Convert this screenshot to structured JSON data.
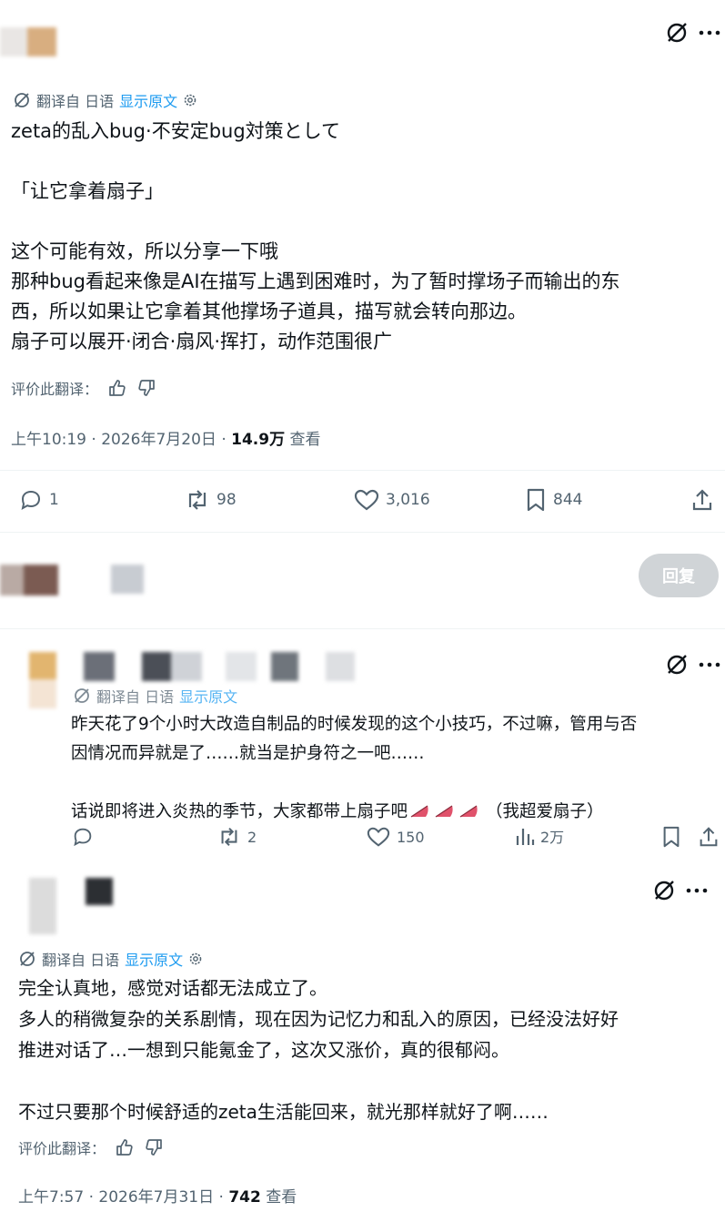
{
  "post1": {
    "translation_bar": {
      "label": "翻译自 日语",
      "show_original": "显示原文"
    },
    "text": "zeta的乱入bug·不安定bug対策として\n\n「让它拿着扇子」\n\n这个可能有效，所以分享一下哦\n那种bug看起来像是AI在描写上遇到困难时，为了暂时撑场子而输出的东\n西，所以如果让它拿着其他撑场子道具，描写就会转向那边。\n扇子可以展开·闭合·扇风·挥打，动作范围很广",
    "rate_label": "评价此翻译：",
    "time": "上午10:19 · 2026年7月20日 · ",
    "views": "14.9万",
    "views_suffix": " 查看",
    "actions": {
      "replies": "1",
      "reposts": "98",
      "likes": "3,016",
      "bookmarks": "844"
    }
  },
  "reply_box": {
    "button": "回复"
  },
  "post2": {
    "translation_bar": {
      "label": "翻译自 日语",
      "show_original": "显示原文"
    },
    "text": "昨天花了9个小时大改造自制品的时候发现的这个小技巧，不过嘛，管用与否\n因情况而异就是了……就当是护身符之一吧……\n\n话说即将进入炎热的季节，大家都带上扇子吧",
    "text_tail": "（我超爱扇子）",
    "actions": {
      "reposts": "2",
      "likes": "150",
      "views": "2万"
    }
  },
  "post3": {
    "translation_bar": {
      "label": "翻译自 日语",
      "show_original": "显示原文"
    },
    "text": "完全认真地，感觉对话都无法成立了。\n多人的稍微复杂的关系剧情，现在因为记忆力和乱入的原因，已经没法好好\n推进对话了…一想到只能氪金了，这次又涨价，真的很郁闷。\n\n不过只要那个时候舒适的zeta生活能回来，就光那样就好了啊……",
    "rate_label": "评价此翻译：",
    "time": "上午7:57 · 2026年7月31日 · ",
    "views": "742",
    "views_suffix": " 查看"
  },
  "colors": {
    "accent": "#1d9bf0",
    "muted": "#536471",
    "text": "#0f1419",
    "fan": "#e0526b"
  }
}
